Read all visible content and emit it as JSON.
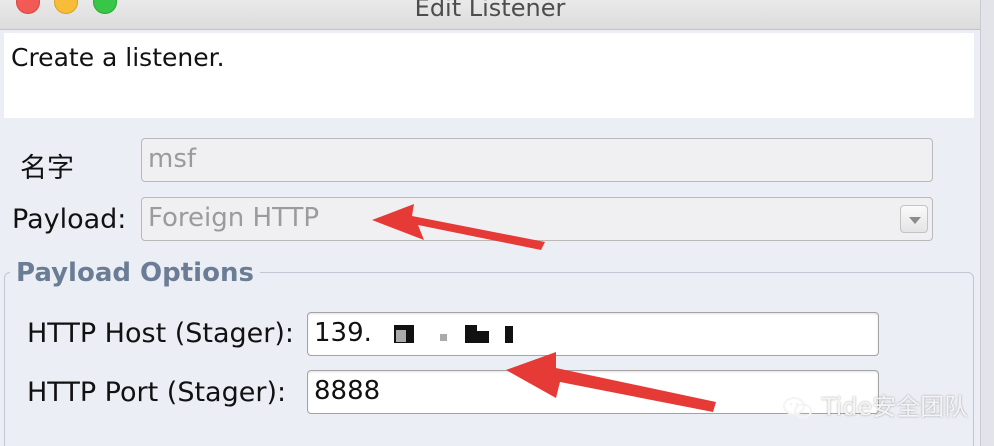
{
  "window": {
    "title": "Edit Listener"
  },
  "description": "Create a listener.",
  "form": {
    "name_label": "名字",
    "name_value": "msf",
    "payload_label": "Payload:",
    "payload_value": "Foreign HTTP"
  },
  "payload_options": {
    "title": "Payload Options",
    "host_label": "HTTP Host (Stager):",
    "host_value": "139.",
    "port_label": "HTTP Port (Stager):",
    "port_value": "8888"
  },
  "watermark": {
    "text": "Tide安全团队",
    "icon": "wechat-icon"
  },
  "colors": {
    "annotation_arrow": "#e63a36",
    "group_title": "#6b7d95"
  }
}
